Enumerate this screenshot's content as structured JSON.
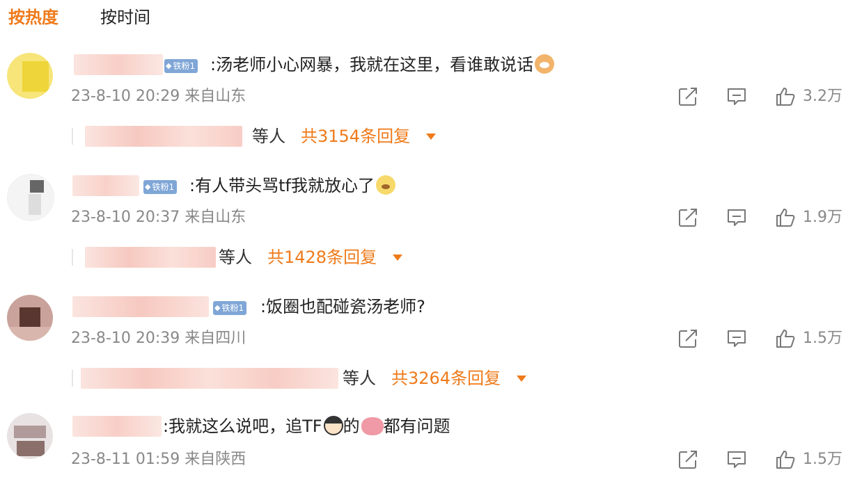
{
  "tabs": {
    "hot": "按热度",
    "time": "按时间"
  },
  "badge": "铁粉1",
  "badge_icon": "diamond-icon",
  "colors": {
    "accent": "#ef7a1a",
    "badge": "#7fa6d6",
    "meta": "#888888",
    "name_blur": "#f7cfc8"
  },
  "reply_etc": "等人",
  "comments": [
    {
      "text": ":汤老师小心网暴，我就在这里，看谁敢说话",
      "emoji": "cat-face-emoji",
      "time": "23-8-10 20:29",
      "location": "来自山东",
      "likes": "3.2万",
      "replies": "共3154条回复"
    },
    {
      "text": ":有人带头骂tf我就放心了",
      "emoji": "dog-face-emoji",
      "time": "23-8-10 20:37",
      "location": "来自山东",
      "likes": "1.9万",
      "replies": "共1428条回复"
    },
    {
      "text": ":饭圈也配碰瓷汤老师?",
      "emoji": "",
      "time": "23-8-10 20:39",
      "location": "来自四川",
      "likes": "1.5万",
      "replies": "共3264条回复"
    },
    {
      "text_a": ":我就这么说吧，追TF",
      "text_b": "的",
      "text_c": "都有问题",
      "emoji_a": "boy-face-emoji",
      "emoji_b": "brain-emoji",
      "time": "23-8-11 01:59",
      "location": "来自陕西",
      "likes": "1.5万"
    }
  ]
}
